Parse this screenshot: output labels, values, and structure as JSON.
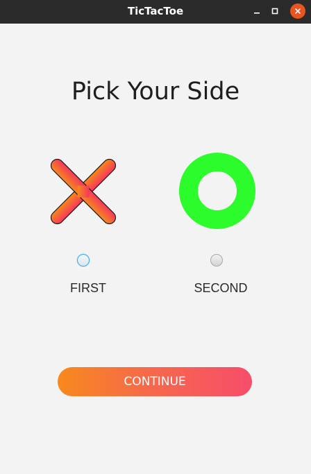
{
  "window": {
    "title": "TicTacToe",
    "controls": [
      "minimize",
      "maximize",
      "close"
    ]
  },
  "main": {
    "heading": "Pick Your Side",
    "options": [
      {
        "label": "FIRST",
        "symbol": "x-mark",
        "selected": true
      },
      {
        "label": "SECOND",
        "symbol": "o-mark",
        "selected": false
      }
    ],
    "continue_label": "CONTINUE"
  },
  "colors": {
    "titlebar": "#2b2b2b",
    "background": "#f3f3f3",
    "x_gradient_start": "#f7891d",
    "x_gradient_end": "#f5365c",
    "o_color": "#2cfb2c",
    "button_gradient_start": "#f7891d",
    "button_gradient_end": "#f74d6a",
    "close_button": "#e95420",
    "radio_focus": "#3aa8dc"
  }
}
